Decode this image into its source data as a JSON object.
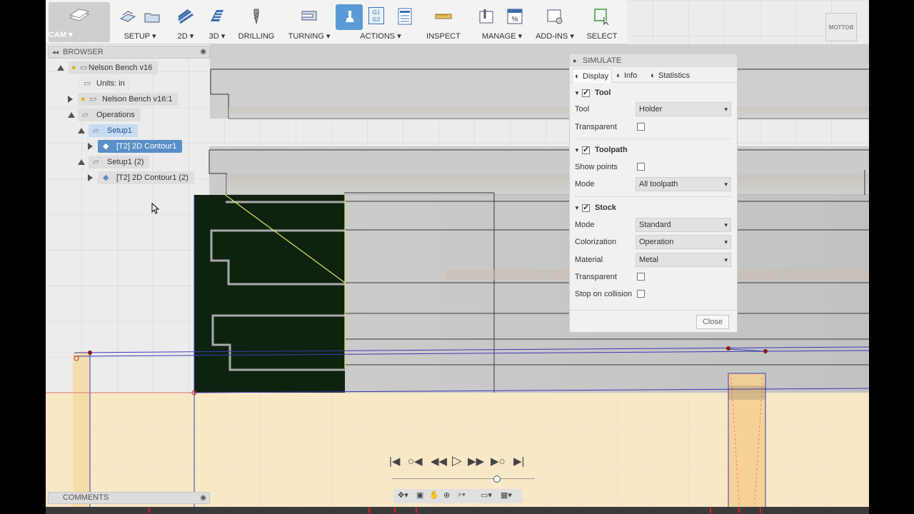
{
  "toolbar": {
    "cam_label": "CAM ▾",
    "groups": [
      {
        "label": "SETUP ▾"
      },
      {
        "label": "2D ▾"
      },
      {
        "label": "3D ▾"
      },
      {
        "label": "DRILLING"
      },
      {
        "label": "TURNING ▾"
      },
      {
        "label": "ACTIONS ▾"
      },
      {
        "label": "INSPECT"
      },
      {
        "label": "MANAGE ▾"
      },
      {
        "label": "ADD-INS ▾"
      },
      {
        "label": "SELECT"
      }
    ],
    "actions_icon_text": "G1 G2"
  },
  "browser": {
    "title": "BROWSER",
    "items": [
      {
        "label": "Nelson Bench v16"
      },
      {
        "label": "Units: in"
      },
      {
        "label": "Nelson Bench v16:1"
      },
      {
        "label": "Operations"
      },
      {
        "label": "Setup1"
      },
      {
        "label": "[T2] 2D Contour1"
      },
      {
        "label": "Setup1 (2)"
      },
      {
        "label": "[T2] 2D Contour1 (2)"
      }
    ]
  },
  "simulate": {
    "title": "SIMULATE",
    "tabs": [
      "Display",
      "Info",
      "Statistics"
    ],
    "tool": {
      "heading": "Tool",
      "tool_label": "Tool",
      "tool_value": "Holder",
      "transparent_label": "Transparent"
    },
    "toolpath": {
      "heading": "Toolpath",
      "show_points_label": "Show points",
      "mode_label": "Mode",
      "mode_value": "All toolpath"
    },
    "stock": {
      "heading": "Stock",
      "mode_label": "Mode",
      "mode_value": "Standard",
      "colorization_label": "Colorization",
      "colorization_value": "Operation",
      "material_label": "Material",
      "material_value": "Metal",
      "transparent_label": "Transparent",
      "stop_label": "Stop on collision"
    },
    "close_label": "Close"
  },
  "comments": {
    "title": "COMMENTS"
  },
  "viewcube": {
    "face_label": "BOTTOM"
  },
  "colors": {
    "stock_dark": "#0f2210",
    "toolpath_yellow": "#e2e85a",
    "sketch_blue": "#3b39b7",
    "part_tan": "#fbe7c0",
    "accent_blue": "#5b9bd5"
  }
}
